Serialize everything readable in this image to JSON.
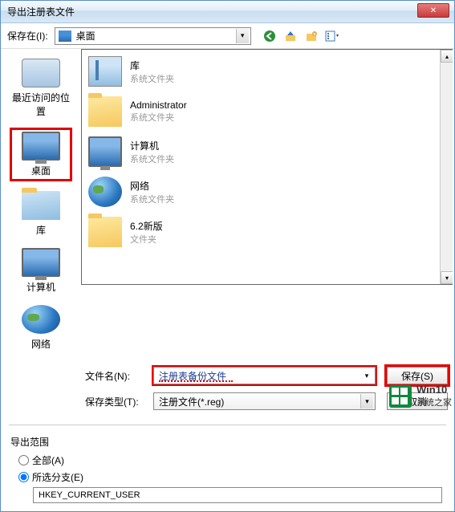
{
  "title": "导出注册表文件",
  "saveIn": {
    "label": "保存在(I):",
    "value": "桌面"
  },
  "toolbarIcons": [
    "back",
    "up",
    "new-folder",
    "views"
  ],
  "sidebar": {
    "items": [
      {
        "label": "最近访问的位置"
      },
      {
        "label": "桌面"
      },
      {
        "label": "库"
      },
      {
        "label": "计算机"
      },
      {
        "label": "网络"
      }
    ]
  },
  "files": [
    {
      "name": "库",
      "sub": "系统文件夹",
      "icon": "lib"
    },
    {
      "name": "Administrator",
      "sub": "系统文件夹",
      "icon": "folder"
    },
    {
      "name": "计算机",
      "sub": "系统文件夹",
      "icon": "monitor"
    },
    {
      "name": "网络",
      "sub": "系统文件夹",
      "icon": "globe"
    },
    {
      "name": "6.2新版",
      "sub": "文件夹",
      "icon": "folder"
    }
  ],
  "filename": {
    "label": "文件名(N):",
    "value": "注册表备份文件"
  },
  "filetype": {
    "label": "保存类型(T):",
    "value": "注册文件(*.reg)"
  },
  "buttons": {
    "save": "保存(S)",
    "cancel": "取消"
  },
  "exportRange": {
    "legend": "导出范围",
    "all": "全部(A)",
    "selected": "所选分支(E)",
    "branch": "HKEY_CURRENT_USER"
  },
  "watermark": {
    "line1": "Win10",
    "line2": "系统之家"
  }
}
